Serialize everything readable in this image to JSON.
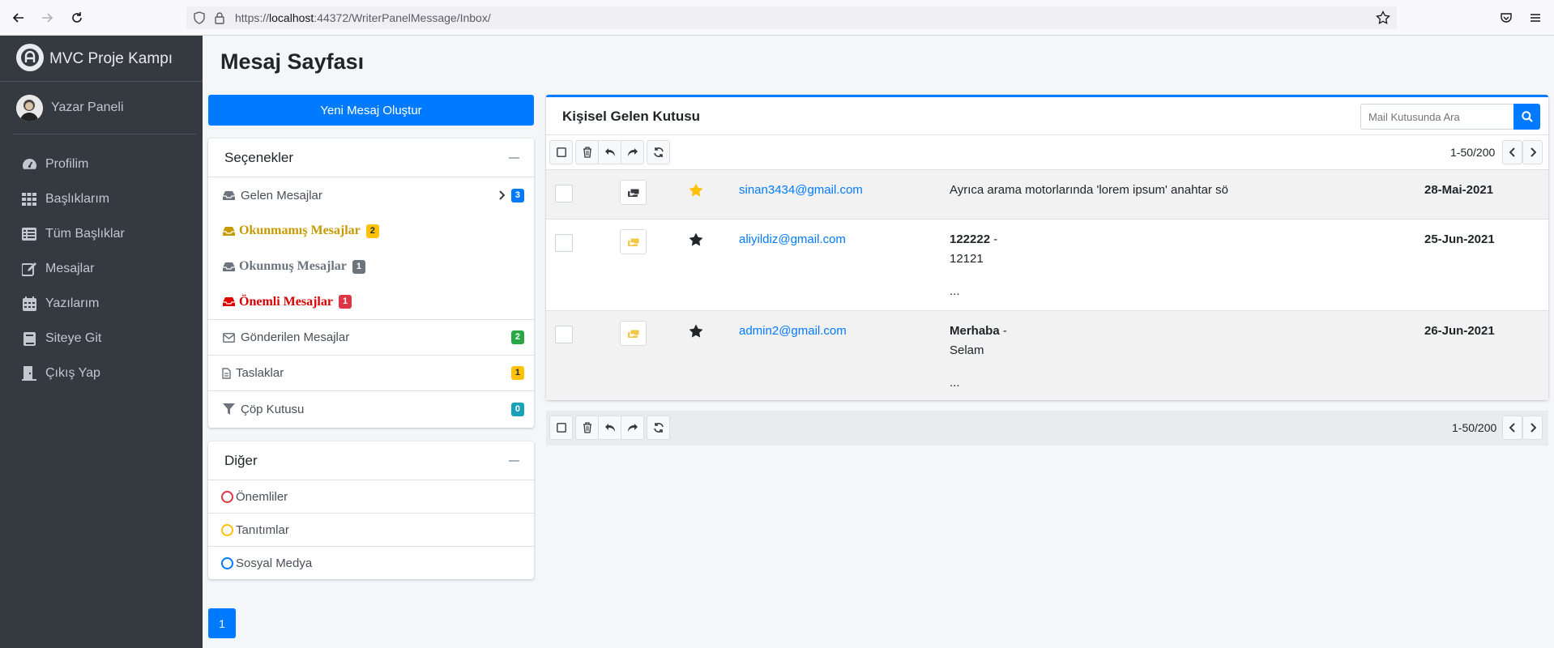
{
  "browser": {
    "url_prefix": "https://",
    "url_host": "localhost",
    "url_rest": ":44372/WriterPanelMessage/Inbox/"
  },
  "sidebar": {
    "brand": "MVC Proje Kampı",
    "user": "Yazar Paneli",
    "items": [
      {
        "label": "Profilim",
        "icon": "dashboard-icon"
      },
      {
        "label": "Başlıklarım",
        "icon": "grid-icon"
      },
      {
        "label": "Tüm Başlıklar",
        "icon": "list-icon"
      },
      {
        "label": "Mesajlar",
        "icon": "edit-icon"
      },
      {
        "label": "Yazılarım",
        "icon": "calendar-icon"
      },
      {
        "label": "Siteye Git",
        "icon": "book-icon"
      },
      {
        "label": "Çıkış Yap",
        "icon": "door-icon"
      }
    ]
  },
  "page": {
    "title": "Mesaj Sayfası",
    "new_message": "Yeni Mesaj Oluştur",
    "page_number": "1"
  },
  "options": {
    "title": "Seçenekler",
    "inbox": {
      "label": "Gelen Mesajlar",
      "count": "3"
    },
    "unread": {
      "label": "Okunmamış Mesajlar",
      "count": "2"
    },
    "read": {
      "label": "Okunmuş Mesajlar",
      "count": "1"
    },
    "important": {
      "label": "Önemli Mesajlar",
      "count": "1"
    },
    "sent": {
      "label": "Gönderilen Mesajlar",
      "count": "2"
    },
    "drafts": {
      "label": "Taslaklar",
      "count": "1"
    },
    "trash": {
      "label": "Çöp Kutusu",
      "count": "0"
    }
  },
  "other": {
    "title": "Diğer",
    "items": [
      {
        "label": "Önemliler",
        "color": "#dc3545"
      },
      {
        "label": "Tanıtımlar",
        "color": "#ffc107"
      },
      {
        "label": "Sosyal Medya",
        "color": "#007bff"
      }
    ]
  },
  "inbox": {
    "title": "Kişisel Gelen Kutusu",
    "search_placeholder": "Mail Kutusunda Ara",
    "pager": "1-50/200",
    "messages": [
      {
        "from": "sinan3434@gmail.com",
        "subject_bold": "",
        "subject": "Ayrıca arama motorlarında 'lorem ipsum' anahtar sö",
        "date": "28-Mai-2021",
        "starred": true
      },
      {
        "from": "aliyildiz@gmail.com",
        "subject_bold": "122222",
        "subject_sep": " -",
        "subject": "12121",
        "ellipsis": "...",
        "date": "25-Jun-2021",
        "starred": false
      },
      {
        "from": "admin2@gmail.com",
        "subject_bold": "Merhaba",
        "subject_sep": " -",
        "subject": "Selam",
        "ellipsis": "...",
        "date": "26-Jun-2021",
        "starred": false
      }
    ]
  },
  "colors": {
    "primary": "#007bff",
    "sidebar": "#343a40",
    "star_active": "#ffc107",
    "unread": "#c79a00",
    "important": "#dc0000"
  }
}
